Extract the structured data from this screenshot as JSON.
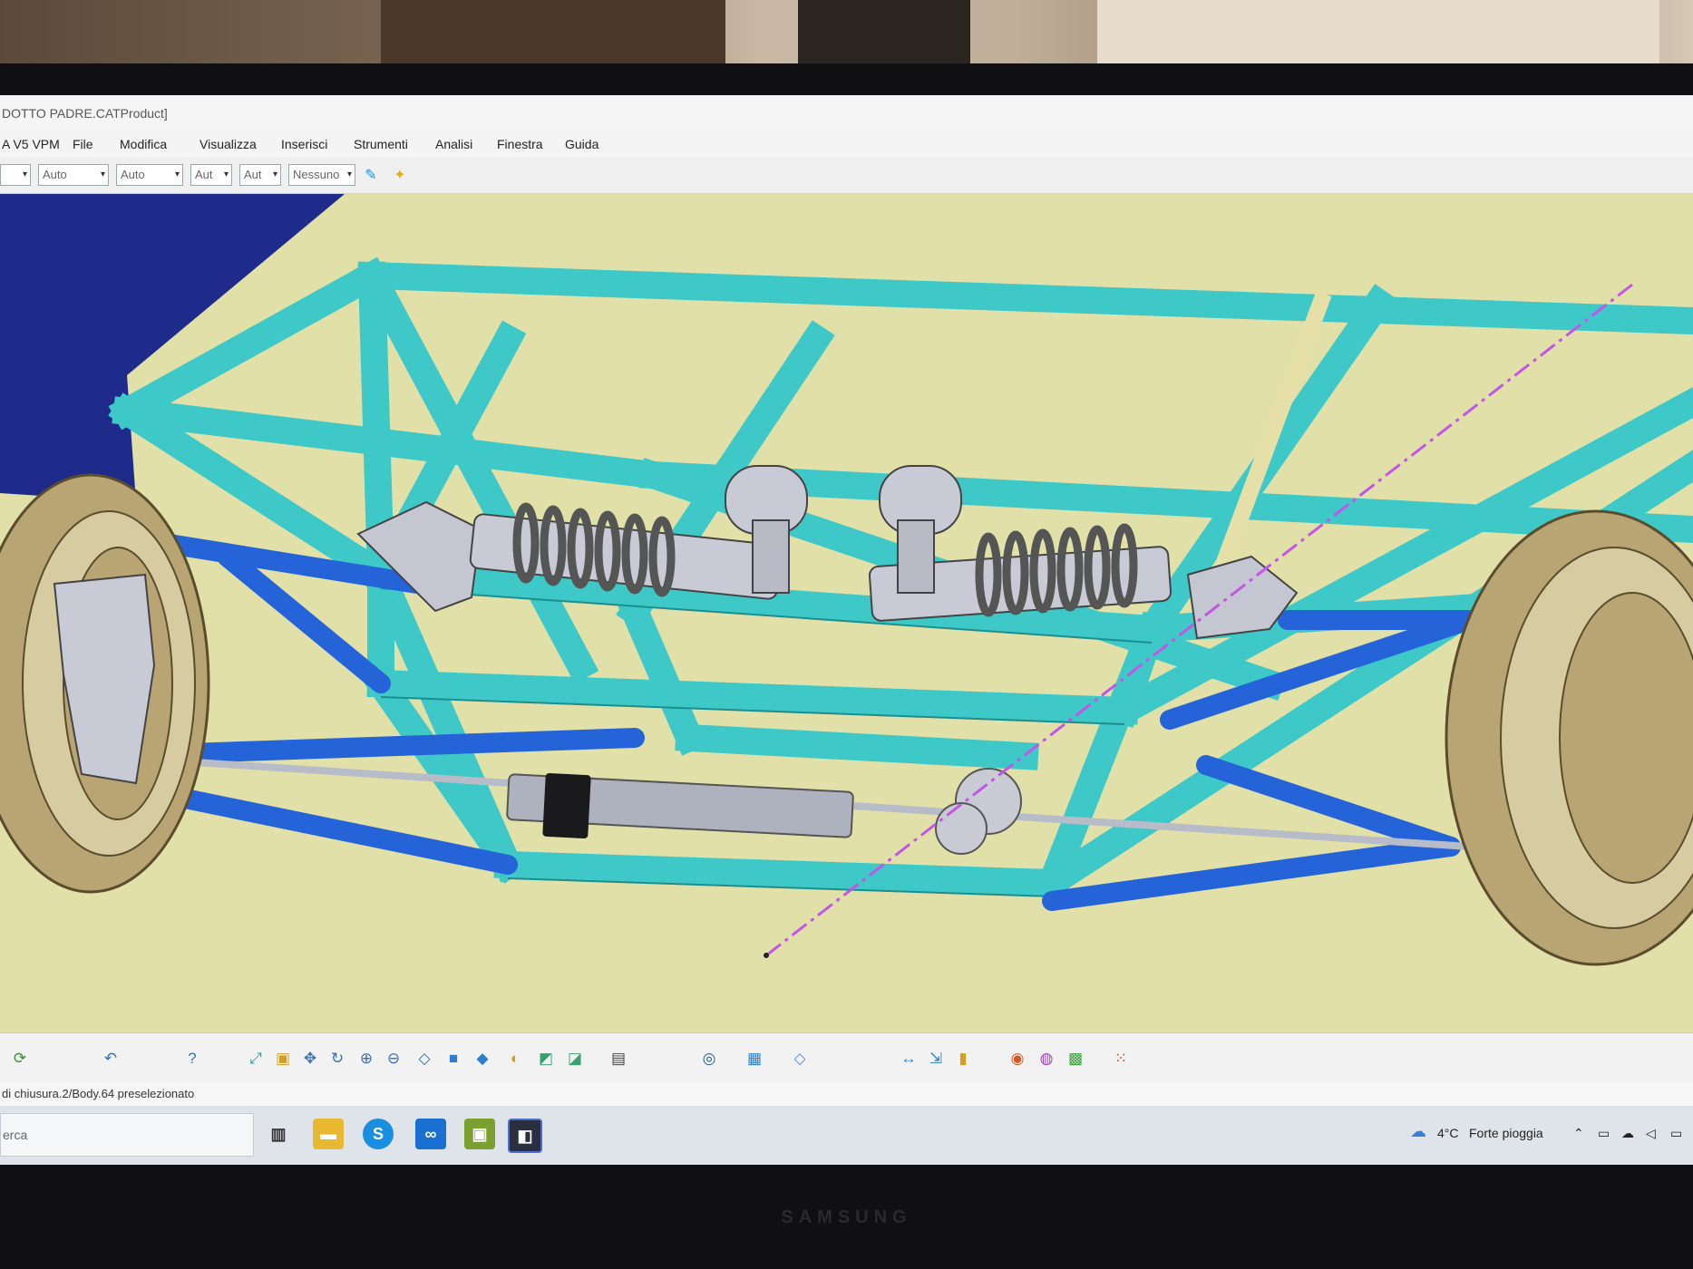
{
  "window": {
    "title": "DOTTO PADRE.CATProduct]"
  },
  "menu": {
    "app_label": "A V5 VPM",
    "items": [
      "File",
      "Modifica",
      "Visualizza",
      "Inserisci",
      "Strumenti",
      "Analisi",
      "Finestra",
      "Guida"
    ]
  },
  "toolbar": {
    "selects": [
      "",
      "Auto",
      "Auto",
      "Aut",
      "Aut",
      "Nessuno"
    ]
  },
  "status": {
    "text": "di chiusura.2/Body.64 preselezionato"
  },
  "taskbar": {
    "search_text": "erca",
    "weather_temp": "4°C",
    "weather_text": "Forte pioggia"
  },
  "monitor": {
    "brand": "SAMSUNG"
  },
  "colors": {
    "frame_tube": "#3ec8c8",
    "wishbone": "#2464d8",
    "background": "#e1e0a8",
    "wheel_rim": "#b9a473",
    "axis_line": "#c455e6"
  },
  "icons": [
    "paint-icon",
    "lamp-icon",
    "pan-icon",
    "zoom-in-icon",
    "zoom-out-icon",
    "rotate-icon",
    "camera-icon",
    "measure-icon",
    "weather-icon"
  ]
}
